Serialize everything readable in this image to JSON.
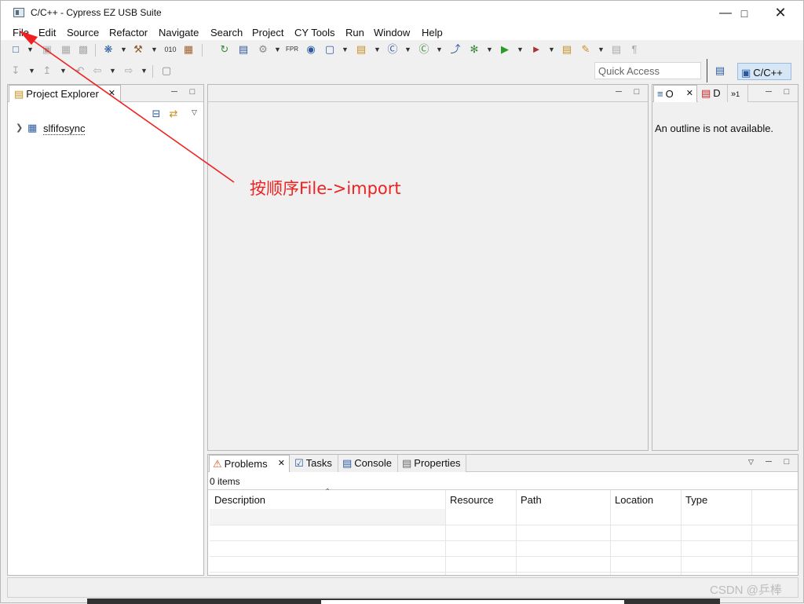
{
  "window": {
    "title": "C/C++ - Cypress EZ USB Suite",
    "controls": [
      "minimize",
      "maximize",
      "close"
    ]
  },
  "menu": [
    "File",
    "Edit",
    "Source",
    "Refactor",
    "Navigate",
    "Search",
    "Project",
    "CY Tools",
    "Run",
    "Window",
    "Help"
  ],
  "quick_access": {
    "placeholder": "Quick Access"
  },
  "perspective": {
    "label": "C/C++"
  },
  "project_explorer": {
    "tab_label": "Project Explorer",
    "items": [
      {
        "label": "slfifosync"
      }
    ]
  },
  "outline": {
    "tab_label": "O",
    "tab2_label": "D",
    "overflow_label": "1",
    "message": "An outline is not available."
  },
  "bottom": {
    "tabs": [
      "Problems",
      "Tasks",
      "Console",
      "Properties"
    ],
    "summary": "0 items",
    "columns": [
      "Description",
      "Resource",
      "Path",
      "Location",
      "Type"
    ]
  },
  "annotation": {
    "text": "按顺序File->import",
    "color": "#ee2222"
  },
  "watermark": "CSDN @乒棒",
  "colors": {
    "accent": "#2c5aa0",
    "perspective_bg": "#d7e6f5",
    "annotation": "#ee2222"
  }
}
